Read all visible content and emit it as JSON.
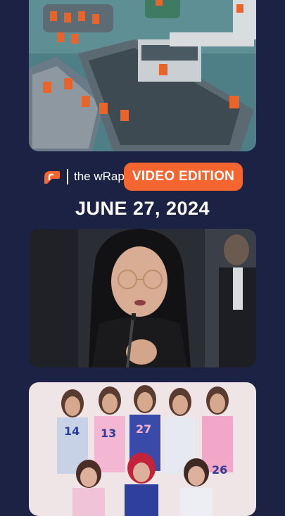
{
  "brand": {
    "logo": "rappler-logo",
    "show_name": "the wRap",
    "edition_label": "VIDEO EDITION",
    "accent": "#f4652f"
  },
  "episode": {
    "date": "JUNE 27, 2024"
  },
  "stories": [
    {
      "image": "coast-guard-boats-photo"
    },
    {
      "image": "senate-hearing-photo"
    },
    {
      "image": "girl-group-performers-photo"
    }
  ],
  "colors": {
    "background": "#1c2244"
  }
}
